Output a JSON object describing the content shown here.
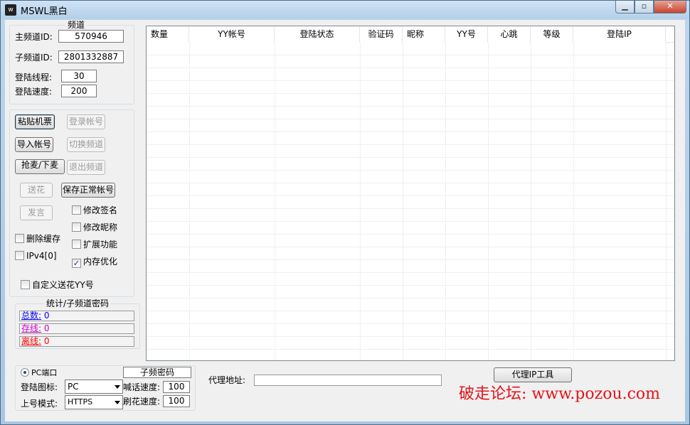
{
  "window": {
    "title": "MSWL黑白",
    "icon_text": "w",
    "min": "▁",
    "max": "▫",
    "close": "✕"
  },
  "channel": {
    "legend": "频道",
    "main_label": "主频道ID:",
    "main_value": "570946",
    "sub_label": "子频道ID:",
    "sub_value": "2801332887",
    "threads_label": "登陆线程:",
    "threads_value": "30",
    "speed_label": "登陆速度:",
    "speed_value": "200"
  },
  "actions": {
    "paste_ticket": "粘贴机票",
    "login_account": "登录帐号",
    "import_account": "导入帐号",
    "switch_channel": "切换频道",
    "grab_mic": "抢麦/下麦",
    "exit_channel": "退出频道",
    "send_flower": "送花",
    "save_normal": "保存正常帐号",
    "speak": "发言",
    "edit_signature": "修改签名",
    "edit_nickname": "修改昵称",
    "delete_cache": "删除缓存",
    "extend": "扩展功能",
    "ipv4": "IPv4[0]",
    "memory_opt": "内存优化",
    "custom_flower": "自定义送花YY号",
    "check_mark": "✓"
  },
  "stats": {
    "legend": "统计/子频道密码",
    "total_label": "总数:",
    "total_value": "0",
    "online_label": "存线:",
    "online_value": "0",
    "offline_label": "离线:",
    "offline_value": "0",
    "total_color": "#0000ff",
    "online_color": "#cc00cc",
    "offline_color": "#ff0000"
  },
  "table": {
    "columns": [
      "数量",
      "YY帐号",
      "登陆状态",
      "验证码",
      "昵称",
      "YY号",
      "心跳",
      "等级",
      "登陆IP"
    ]
  },
  "bottom": {
    "pc_port": "PC端口",
    "sub_password_label": "子频密码",
    "login_icon_label": "登陆图标:",
    "login_icon_value": "PC",
    "shout_speed_label": "喊话速度:",
    "shout_speed_value": "100",
    "mode_label": "上号模式:",
    "mode_value": "HTTPS",
    "flower_speed_label": "刷花速度:",
    "flower_speed_value": "100",
    "proxy_label": "代理地址:",
    "proxy_value": "",
    "proxy_tool": "代理IP工具"
  },
  "watermark": "破走论坛: www.pozou.com"
}
